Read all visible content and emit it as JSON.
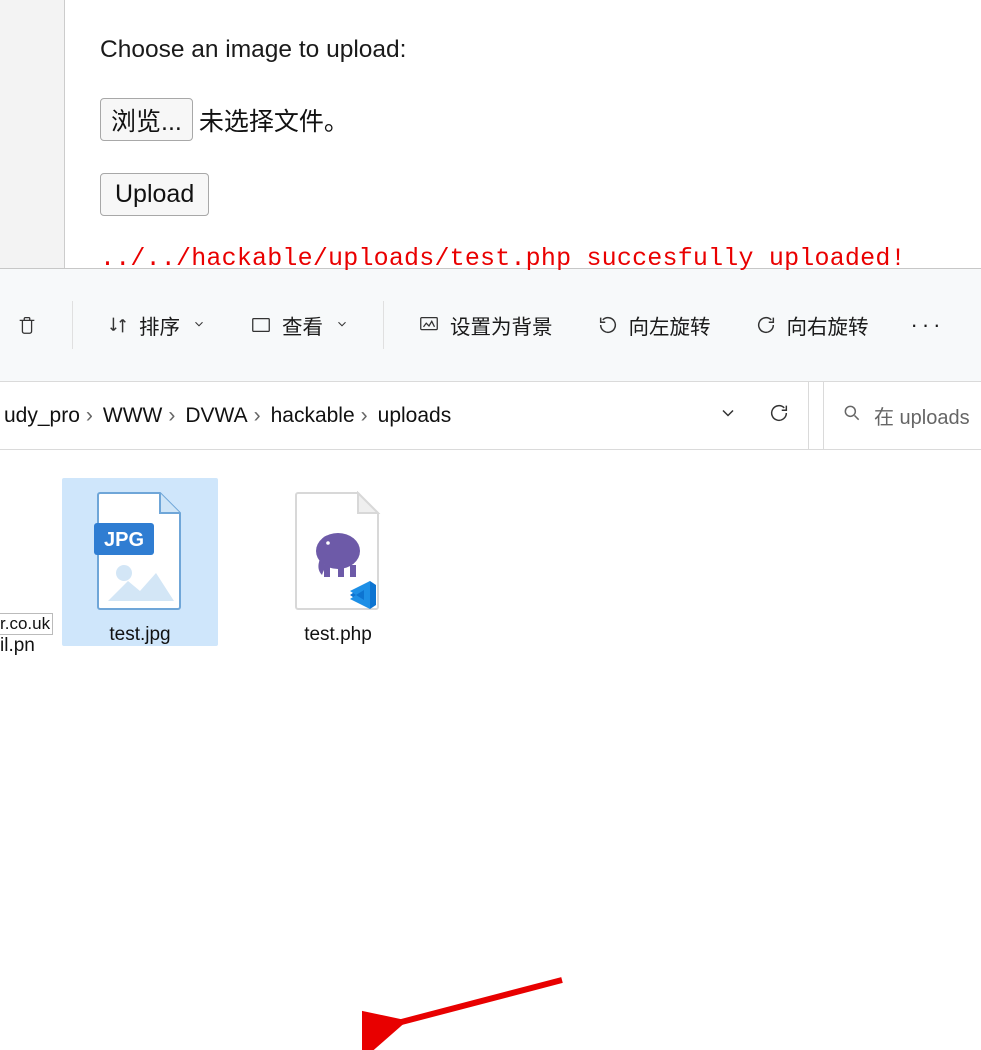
{
  "web": {
    "prompt": "Choose an image to upload:",
    "chooser_label": "浏览...",
    "no_file_text": "未选择文件。",
    "upload_label": "Upload",
    "result": "../../hackable/uploads/test.php succesfully uploaded!"
  },
  "toolbar": {
    "sort_label": "排序",
    "view_label": "查看",
    "set_bg_label": "设置为背景",
    "rotate_left_label": "向左旋转",
    "rotate_right_label": "向右旋转"
  },
  "breadcrumbs": {
    "items": [
      "udy_pro",
      "WWW",
      "DVWA",
      "hackable",
      "uploads"
    ]
  },
  "search": {
    "placeholder": "在 uploads"
  },
  "files": [
    {
      "name": "test.jpg",
      "type": "jpg",
      "selected": true
    },
    {
      "name": "test.php",
      "type": "php",
      "selected": false
    }
  ],
  "misc": {
    "cut_label": "r.co.uk",
    "cut_label2": "il.pn"
  }
}
